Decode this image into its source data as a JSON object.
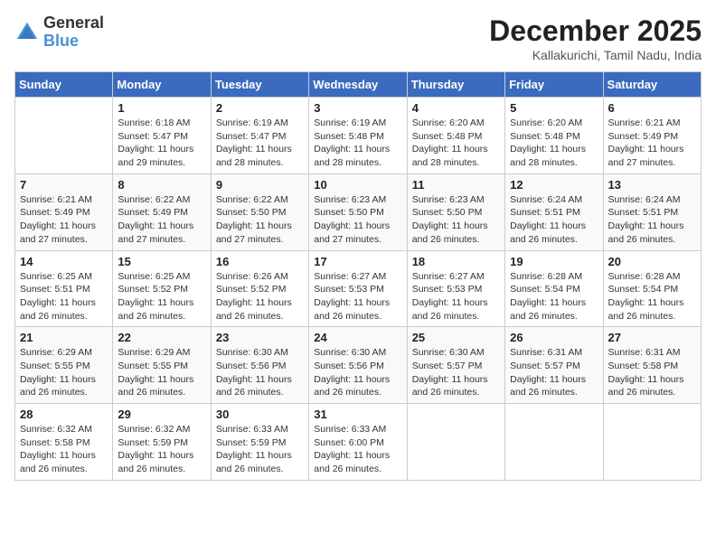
{
  "logo": {
    "general": "General",
    "blue": "Blue"
  },
  "title": {
    "month": "December 2025",
    "location": "Kallakurichi, Tamil Nadu, India"
  },
  "headers": [
    "Sunday",
    "Monday",
    "Tuesday",
    "Wednesday",
    "Thursday",
    "Friday",
    "Saturday"
  ],
  "weeks": [
    [
      {
        "day": "",
        "info": ""
      },
      {
        "day": "1",
        "info": "Sunrise: 6:18 AM\nSunset: 5:47 PM\nDaylight: 11 hours\nand 29 minutes."
      },
      {
        "day": "2",
        "info": "Sunrise: 6:19 AM\nSunset: 5:47 PM\nDaylight: 11 hours\nand 28 minutes."
      },
      {
        "day": "3",
        "info": "Sunrise: 6:19 AM\nSunset: 5:48 PM\nDaylight: 11 hours\nand 28 minutes."
      },
      {
        "day": "4",
        "info": "Sunrise: 6:20 AM\nSunset: 5:48 PM\nDaylight: 11 hours\nand 28 minutes."
      },
      {
        "day": "5",
        "info": "Sunrise: 6:20 AM\nSunset: 5:48 PM\nDaylight: 11 hours\nand 28 minutes."
      },
      {
        "day": "6",
        "info": "Sunrise: 6:21 AM\nSunset: 5:49 PM\nDaylight: 11 hours\nand 27 minutes."
      }
    ],
    [
      {
        "day": "7",
        "info": "Sunrise: 6:21 AM\nSunset: 5:49 PM\nDaylight: 11 hours\nand 27 minutes."
      },
      {
        "day": "8",
        "info": "Sunrise: 6:22 AM\nSunset: 5:49 PM\nDaylight: 11 hours\nand 27 minutes."
      },
      {
        "day": "9",
        "info": "Sunrise: 6:22 AM\nSunset: 5:50 PM\nDaylight: 11 hours\nand 27 minutes."
      },
      {
        "day": "10",
        "info": "Sunrise: 6:23 AM\nSunset: 5:50 PM\nDaylight: 11 hours\nand 27 minutes."
      },
      {
        "day": "11",
        "info": "Sunrise: 6:23 AM\nSunset: 5:50 PM\nDaylight: 11 hours\nand 26 minutes."
      },
      {
        "day": "12",
        "info": "Sunrise: 6:24 AM\nSunset: 5:51 PM\nDaylight: 11 hours\nand 26 minutes."
      },
      {
        "day": "13",
        "info": "Sunrise: 6:24 AM\nSunset: 5:51 PM\nDaylight: 11 hours\nand 26 minutes."
      }
    ],
    [
      {
        "day": "14",
        "info": "Sunrise: 6:25 AM\nSunset: 5:51 PM\nDaylight: 11 hours\nand 26 minutes."
      },
      {
        "day": "15",
        "info": "Sunrise: 6:25 AM\nSunset: 5:52 PM\nDaylight: 11 hours\nand 26 minutes."
      },
      {
        "day": "16",
        "info": "Sunrise: 6:26 AM\nSunset: 5:52 PM\nDaylight: 11 hours\nand 26 minutes."
      },
      {
        "day": "17",
        "info": "Sunrise: 6:27 AM\nSunset: 5:53 PM\nDaylight: 11 hours\nand 26 minutes."
      },
      {
        "day": "18",
        "info": "Sunrise: 6:27 AM\nSunset: 5:53 PM\nDaylight: 11 hours\nand 26 minutes."
      },
      {
        "day": "19",
        "info": "Sunrise: 6:28 AM\nSunset: 5:54 PM\nDaylight: 11 hours\nand 26 minutes."
      },
      {
        "day": "20",
        "info": "Sunrise: 6:28 AM\nSunset: 5:54 PM\nDaylight: 11 hours\nand 26 minutes."
      }
    ],
    [
      {
        "day": "21",
        "info": "Sunrise: 6:29 AM\nSunset: 5:55 PM\nDaylight: 11 hours\nand 26 minutes."
      },
      {
        "day": "22",
        "info": "Sunrise: 6:29 AM\nSunset: 5:55 PM\nDaylight: 11 hours\nand 26 minutes."
      },
      {
        "day": "23",
        "info": "Sunrise: 6:30 AM\nSunset: 5:56 PM\nDaylight: 11 hours\nand 26 minutes."
      },
      {
        "day": "24",
        "info": "Sunrise: 6:30 AM\nSunset: 5:56 PM\nDaylight: 11 hours\nand 26 minutes."
      },
      {
        "day": "25",
        "info": "Sunrise: 6:30 AM\nSunset: 5:57 PM\nDaylight: 11 hours\nand 26 minutes."
      },
      {
        "day": "26",
        "info": "Sunrise: 6:31 AM\nSunset: 5:57 PM\nDaylight: 11 hours\nand 26 minutes."
      },
      {
        "day": "27",
        "info": "Sunrise: 6:31 AM\nSunset: 5:58 PM\nDaylight: 11 hours\nand 26 minutes."
      }
    ],
    [
      {
        "day": "28",
        "info": "Sunrise: 6:32 AM\nSunset: 5:58 PM\nDaylight: 11 hours\nand 26 minutes."
      },
      {
        "day": "29",
        "info": "Sunrise: 6:32 AM\nSunset: 5:59 PM\nDaylight: 11 hours\nand 26 minutes."
      },
      {
        "day": "30",
        "info": "Sunrise: 6:33 AM\nSunset: 5:59 PM\nDaylight: 11 hours\nand 26 minutes."
      },
      {
        "day": "31",
        "info": "Sunrise: 6:33 AM\nSunset: 6:00 PM\nDaylight: 11 hours\nand 26 minutes."
      },
      {
        "day": "",
        "info": ""
      },
      {
        "day": "",
        "info": ""
      },
      {
        "day": "",
        "info": ""
      }
    ]
  ]
}
